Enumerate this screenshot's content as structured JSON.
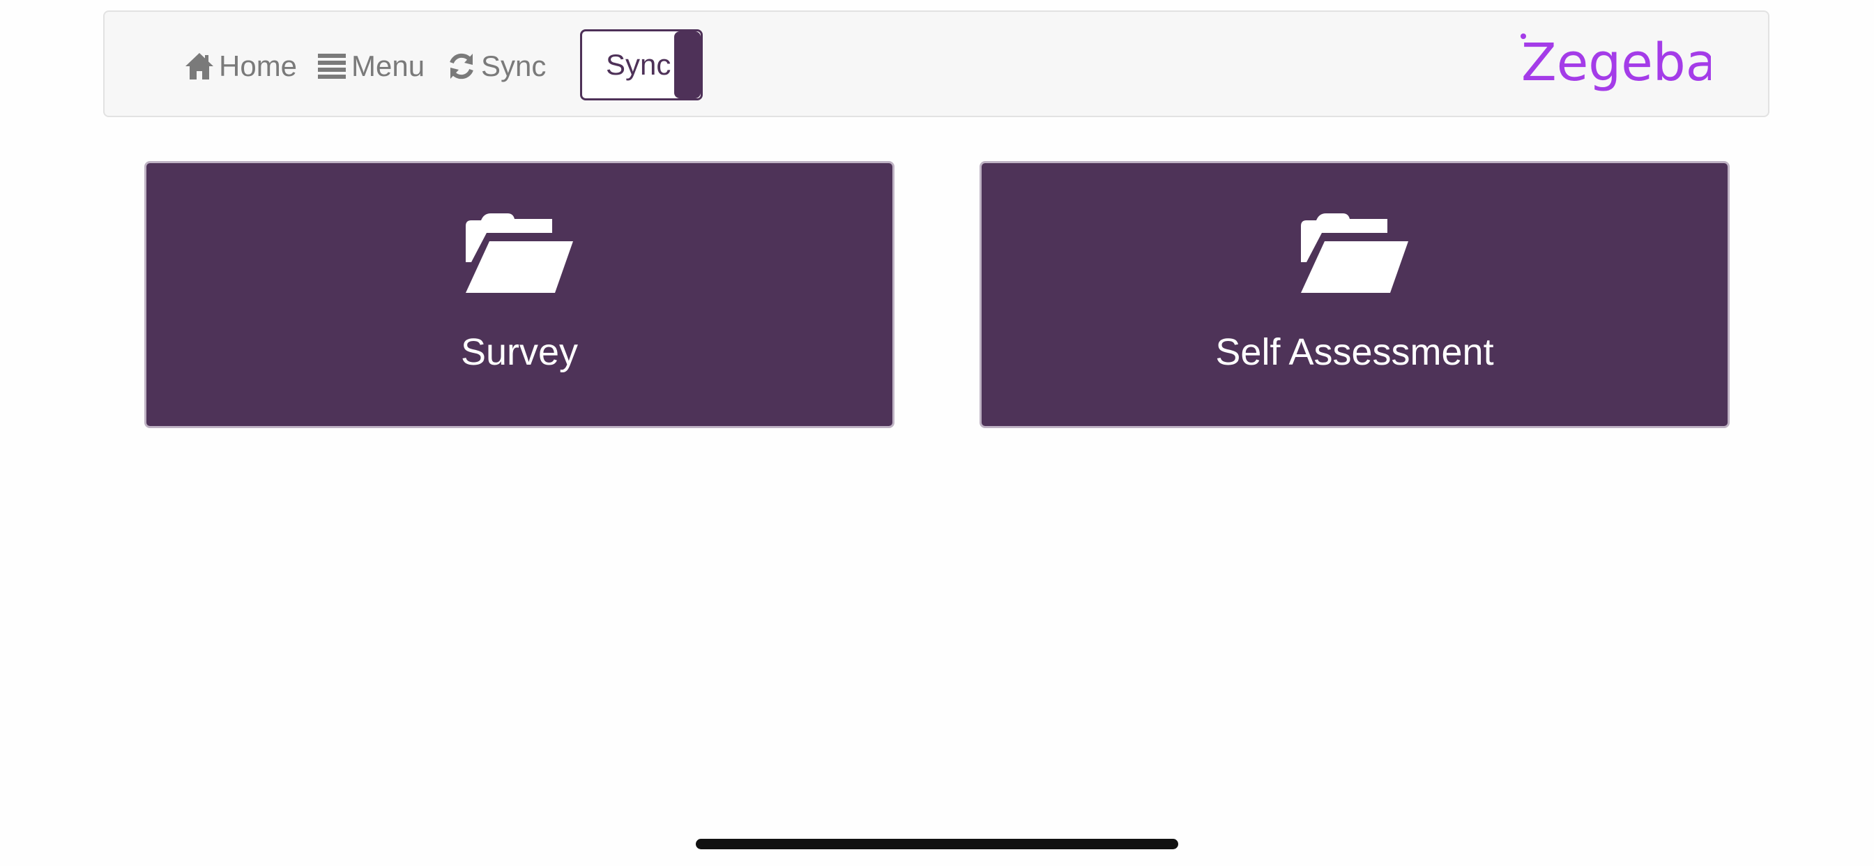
{
  "navbar": {
    "items": [
      {
        "label": "Home",
        "icon": "home-icon"
      },
      {
        "label": "Menu",
        "icon": "menu-icon"
      },
      {
        "label": "Sync",
        "icon": "refresh-icon"
      }
    ],
    "sync_toggle": {
      "label": "Sync",
      "state": "on"
    },
    "logo_text": "Zegeba"
  },
  "tiles": [
    {
      "label": "Survey",
      "icon": "folder-open-icon"
    },
    {
      "label": "Self Assessment",
      "icon": "folder-open-icon"
    }
  ],
  "colors": {
    "tile_background": "#4e3358",
    "accent": "#4e3158",
    "logo": "#a43ce8",
    "nav_text": "#7a7a7a",
    "navbar_background": "#f7f7f7"
  }
}
